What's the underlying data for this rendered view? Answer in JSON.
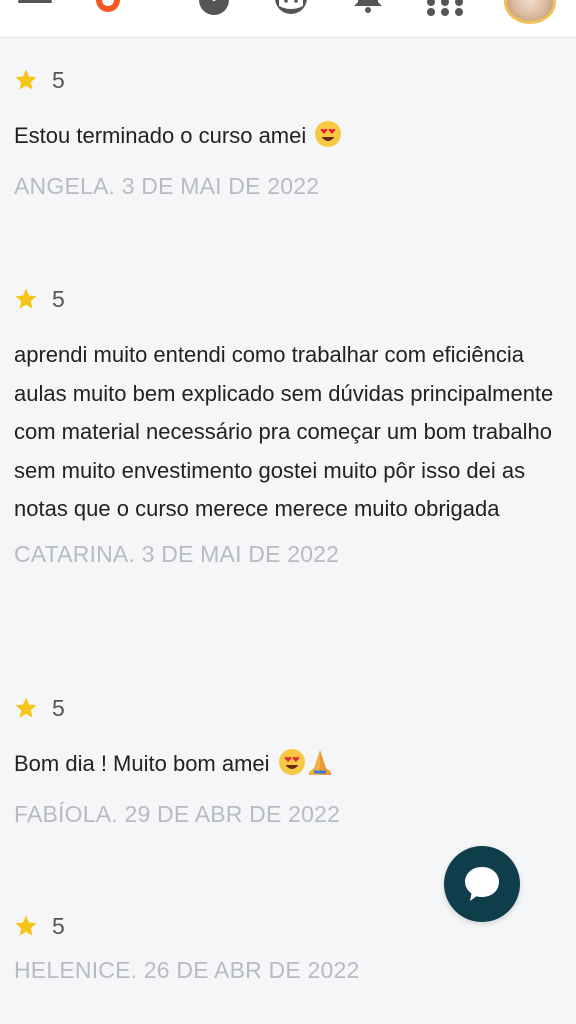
{
  "topbar": {
    "icons": [
      "menu-icon",
      "logo-icon",
      "help-icon",
      "cat-icon",
      "bell-icon",
      "apps-grid-icon",
      "avatar"
    ]
  },
  "reviews": [
    {
      "score": "5",
      "text": "Estou terminado o curso amei",
      "emojis": [
        "heart-eyes"
      ],
      "author": "ANGELA. 3 DE MAI DE 2022"
    },
    {
      "score": "5",
      "text": "aprendi muito entendi como trabalhar com eficiência aulas muito bem explicado sem dúvidas principalmente com material necessário pra começar um bom trabalho sem muito envestimento gostei muito pôr isso dei as notas que o curso merece merece muito obrigada",
      "emojis": [],
      "author": "CATARINA. 3 DE MAI DE 2022"
    },
    {
      "score": "5",
      "text": "Bom dia ! Muito bom amei",
      "emojis": [
        "heart-eyes",
        "folded-hands"
      ],
      "author": "FABÍOLA. 29 DE ABR DE 2022"
    },
    {
      "score": "5",
      "text": "",
      "emojis": [],
      "author": "HELENICE. 26 DE ABR DE 2022"
    }
  ],
  "colors": {
    "star": "#f5c518",
    "author": "#b8bcc2",
    "chat_fab": "#0f3d4c",
    "logo": "#f2581f"
  }
}
